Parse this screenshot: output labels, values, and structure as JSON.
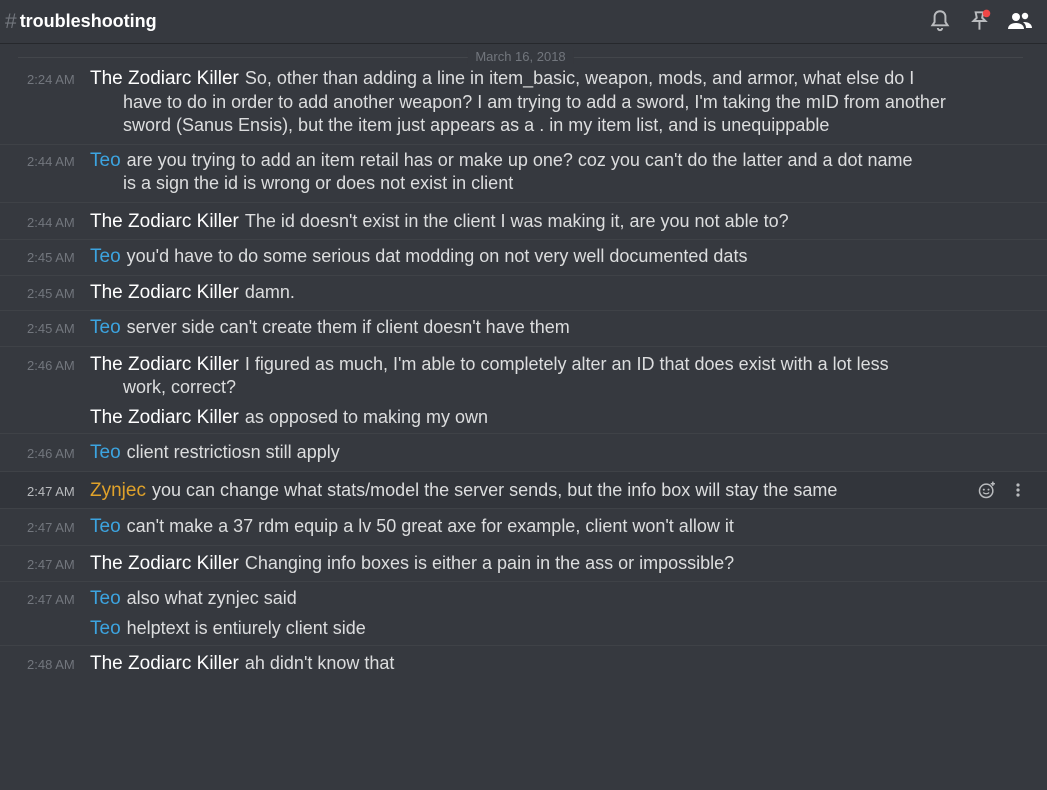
{
  "header": {
    "hash": "#",
    "channel": "troubleshooting"
  },
  "divider": {
    "date": "March 16, 2018"
  },
  "colors": {
    "zodiarc": "#ffffff",
    "teo": "#3ca4e0",
    "zynjec": "#e0a22a"
  },
  "messages": [
    {
      "ts": "2:24 AM",
      "author": "The Zodiarc Killer",
      "lines": [
        "So, other than adding a line in item_basic, weapon, mods, and armor, what else do I",
        "have to do in order to add another weapon? I am trying to add a sword, I'm taking the mID from another",
        "sword (Sanus Ensis), but the item just appears as a . in my item list, and is unequippable"
      ]
    },
    {
      "ts": "2:44 AM",
      "author": "Teo",
      "lines": [
        "are you trying to add an item retail has or make up one? coz you can't do the latter and a dot name",
        "is a sign the id is wrong or does not exist in client"
      ]
    },
    {
      "ts": "2:44 AM",
      "author": "The Zodiarc Killer",
      "lines": [
        "The id doesn't exist in the client I was making it, are you not able to?"
      ]
    },
    {
      "ts": "2:45 AM",
      "author": "Teo",
      "lines": [
        "you'd have to do some serious dat modding on not very well documented dats"
      ]
    },
    {
      "ts": "2:45 AM",
      "author": "The Zodiarc Killer",
      "lines": [
        "damn."
      ]
    },
    {
      "ts": "2:45 AM",
      "author": "Teo",
      "lines": [
        "server side can't create them if client doesn't have them"
      ]
    },
    {
      "ts": "2:46 AM",
      "author": "The Zodiarc Killer",
      "lines": [
        "I figured as much, I'm able to completely alter an ID that does exist with a lot less",
        "work, correct?"
      ],
      "follow": {
        "author": "The Zodiarc Killer",
        "text": "as opposed to making my own"
      }
    },
    {
      "ts": "2:46 AM",
      "author": "Teo",
      "lines": [
        "client restrictiosn still apply"
      ]
    },
    {
      "ts": "2:47 AM",
      "author": "Zynjec",
      "lines": [
        "you can change what stats/model the server sends, but the info box will stay the same"
      ],
      "hover": true
    },
    {
      "ts": "2:47 AM",
      "author": "Teo",
      "lines": [
        "can't make a 37 rdm equip a lv 50 great axe for example, client won't allow it"
      ]
    },
    {
      "ts": "2:47 AM",
      "author": "The Zodiarc Killer",
      "lines": [
        "Changing info boxes is either a pain in the ass or impossible?"
      ]
    },
    {
      "ts": "2:47 AM",
      "author": "Teo",
      "lines": [
        "also what zynjec said"
      ],
      "follow": {
        "author": "Teo",
        "text": "helptext is entiurely client side"
      }
    },
    {
      "ts": "2:48 AM",
      "author": "The Zodiarc Killer",
      "lines": [
        "ah didn't know that"
      ]
    }
  ]
}
